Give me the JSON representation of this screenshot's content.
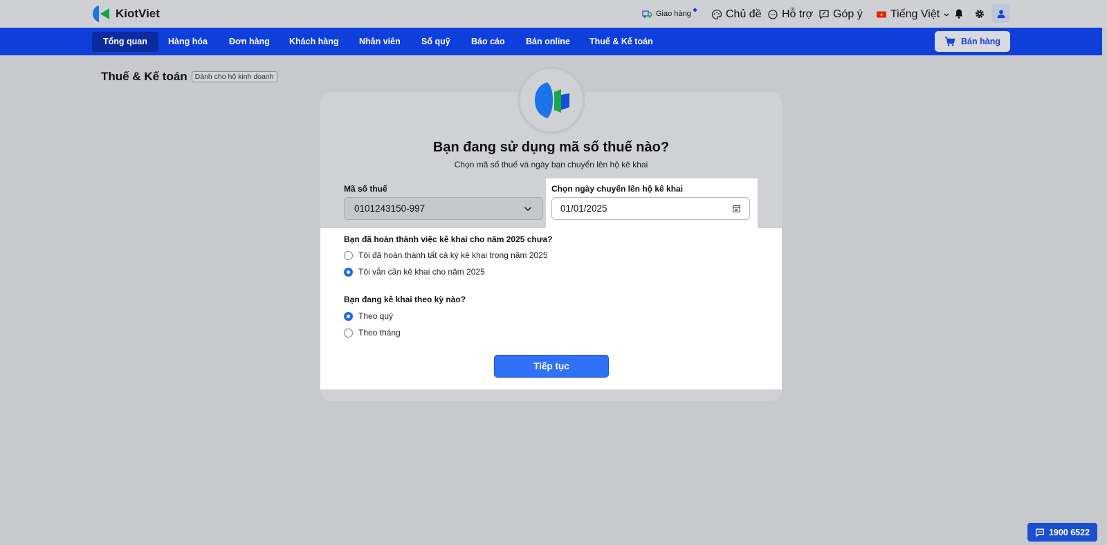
{
  "app": {
    "brand": "KiotViet"
  },
  "topbar": {
    "delivery": "Giao hàng",
    "theme": "Chủ đề",
    "support": "Hỗ trợ",
    "feedback": "Góp ý",
    "language": "Tiếng Việt"
  },
  "nav": {
    "items": [
      "Tổng quan",
      "Hàng hóa",
      "Đơn hàng",
      "Khách hàng",
      "Nhân viên",
      "Sổ quỹ",
      "Báo cáo",
      "Bán online",
      "Thuế & Kế toán"
    ],
    "active_index": 0,
    "sell_button": "Bán hàng"
  },
  "page": {
    "title": "Thuế & Kế toán",
    "badge": "Dành cho hộ kinh doanh"
  },
  "form": {
    "heading": "Bạn đang sử dụng mã số thuế nào?",
    "subheading": "Chọn mã số thuế và ngày bạn chuyển lên hộ kê khai",
    "tax_label": "Mã số thuế",
    "tax_value": "0101243150-997",
    "date_label": "Chọn ngày chuyển lên hộ kê khai",
    "date_value": "01/01/2025",
    "q1": "Bạn đã hoàn thành việc kê khai cho năm 2025 chưa?",
    "q1_opt1": "Tôi đã hoàn thành tất cả kỳ kê khai trong năm 2025",
    "q1_opt2": "Tôi vẫn cần kê khai cho năm 2025",
    "q1_selected": 2,
    "q2": "Bạn đang kê khai theo kỳ nào?",
    "q2_opt1": "Theo quý",
    "q2_opt2": "Theo tháng",
    "q2_selected": 1,
    "continue": "Tiếp tục"
  },
  "hotline": "1900 6522",
  "colors": {
    "primary": "#0e3fdb",
    "accent": "#2f72f6",
    "radio": "#1e6af0"
  }
}
